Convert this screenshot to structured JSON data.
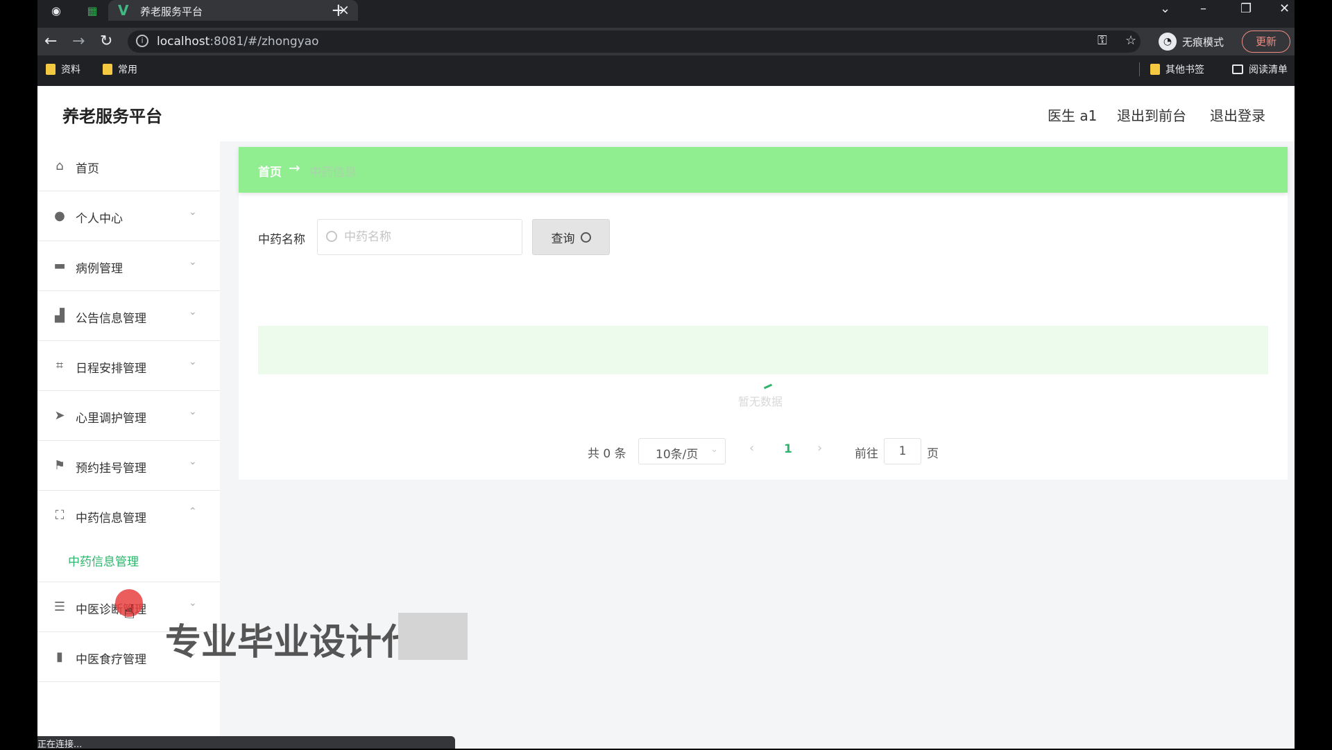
{
  "browser": {
    "tab_title": "养老服务平台",
    "url_host": "localhost",
    "url_rest": ":8081/#/zhongyao",
    "incognito_label": "无痕模式",
    "update_label": "更新",
    "bookmarks": [
      "资料",
      "常用"
    ],
    "other_bookmarks": "其他书签",
    "reading_list": "阅读清单",
    "status_text": "正在连接..."
  },
  "header": {
    "brand": "养老服务平台",
    "user": "医生 a1",
    "to_front": "退出到前台",
    "logout": "退出登录"
  },
  "sidebar": {
    "items": [
      {
        "label": "首页",
        "icon": "home-icon"
      },
      {
        "label": "个人中心",
        "icon": "user-icon"
      },
      {
        "label": "病例管理",
        "icon": "briefcase-icon"
      },
      {
        "label": "公告信息管理",
        "icon": "thumbs-up-icon"
      },
      {
        "label": "日程安排管理",
        "icon": "crop-icon"
      },
      {
        "label": "心里调护管理",
        "icon": "send-icon"
      },
      {
        "label": "预约挂号管理",
        "icon": "flag-icon"
      },
      {
        "label": "中药信息管理",
        "icon": "fullscreen-icon"
      },
      {
        "label": "中医诊断管理",
        "icon": "list-icon"
      },
      {
        "label": "中医食疗管理",
        "icon": "bar-chart-icon"
      }
    ],
    "submenu": "中药信息管理"
  },
  "breadcrumb": {
    "home": "首页",
    "current": "中药信息"
  },
  "search": {
    "label": "中药名称",
    "placeholder": "中药名称",
    "button": "查询"
  },
  "table": {
    "empty_text": "暂无数据"
  },
  "pagination": {
    "total": "共 0 条",
    "page_size": "10条/页",
    "current_page": "1",
    "goto_label": "前往",
    "goto_value": "1",
    "page_suffix": "页"
  },
  "overlay": {
    "watermark": "专业毕业设计代"
  },
  "colors": {
    "accent": "#2cb56b",
    "breadcrumb_bg": "#90ee90",
    "table_head_bg": "#ecfbec"
  }
}
